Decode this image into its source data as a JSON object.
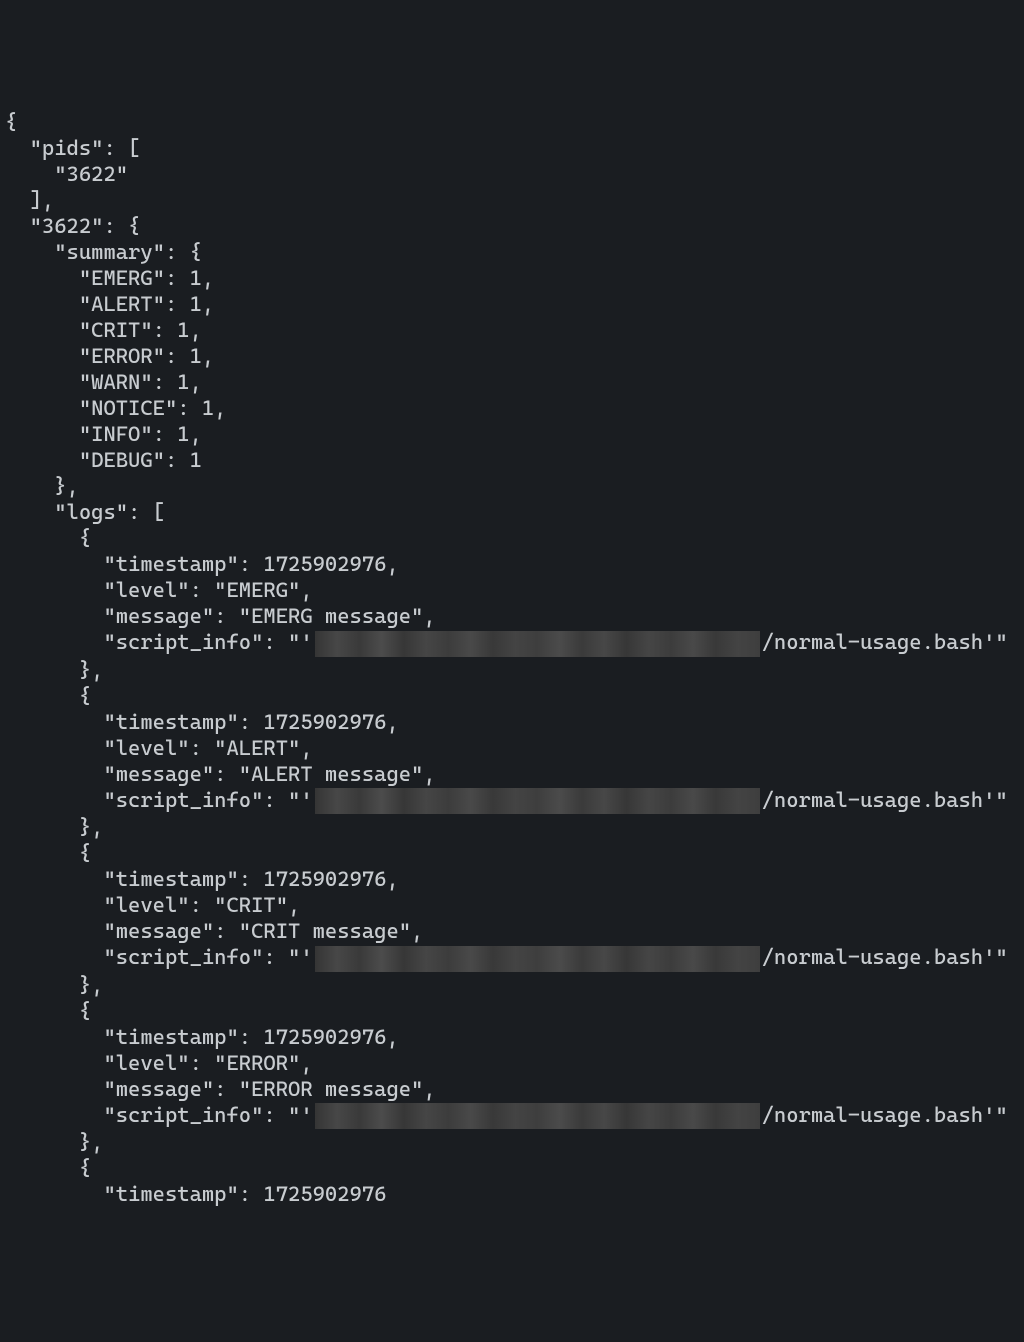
{
  "json_output": {
    "open_brace": "{",
    "pids_key": "  \"pids\": [",
    "pids_value": "    \"3622\"",
    "pids_close": "  ],",
    "pid_key": "  \"3622\": {",
    "summary_key": "    \"summary\": {",
    "summary_emerg": "      \"EMERG\": 1,",
    "summary_alert": "      \"ALERT\": 1,",
    "summary_crit": "      \"CRIT\": 1,",
    "summary_error": "      \"ERROR\": 1,",
    "summary_warn": "      \"WARN\": 1,",
    "summary_notice": "      \"NOTICE\": 1,",
    "summary_info": "      \"INFO\": 1,",
    "summary_debug": "      \"DEBUG\": 1",
    "summary_close": "    },",
    "logs_key": "    \"logs\": [",
    "entry_open": "      {",
    "entry_close": "      },",
    "timestamp_line": "        \"timestamp\": 1725902976,",
    "timestamp_line_partial": "        \"timestamp\": 1725902976",
    "script_prefix": "        \"script_info\": \"'",
    "script_suffix": "/normal-usage.bash'\"",
    "logs": [
      {
        "level_line": "        \"level\": \"EMERG\",",
        "message_line": "        \"message\": \"EMERG message\","
      },
      {
        "level_line": "        \"level\": \"ALERT\",",
        "message_line": "        \"message\": \"ALERT message\","
      },
      {
        "level_line": "        \"level\": \"CRIT\",",
        "message_line": "        \"message\": \"CRIT message\","
      },
      {
        "level_line": "        \"level\": \"ERROR\",",
        "message_line": "        \"message\": \"ERROR message\","
      }
    ]
  }
}
